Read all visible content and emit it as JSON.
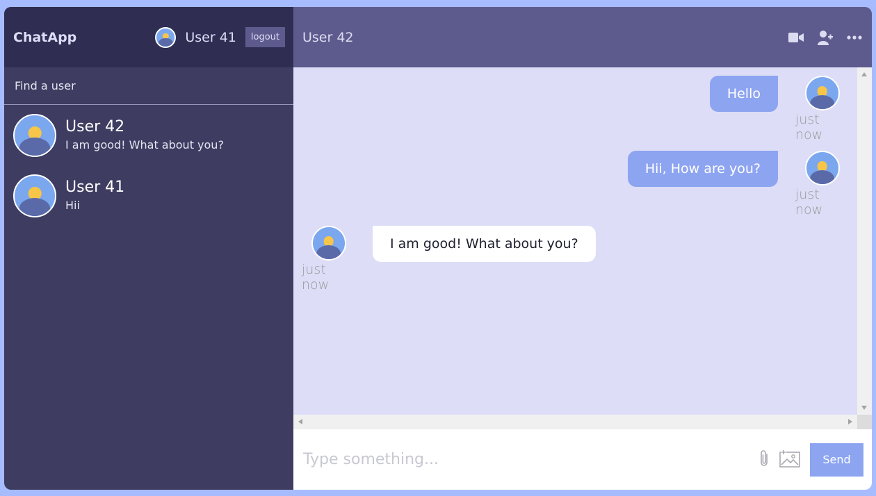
{
  "navbar": {
    "logo": "ChatApp",
    "current_user": "User 41",
    "logout_label": "logout"
  },
  "search": {
    "placeholder": "Find a user"
  },
  "chats": [
    {
      "name": "User 42",
      "last_message": "I am good! What about you?"
    },
    {
      "name": "User 41",
      "last_message": "Hii"
    }
  ],
  "chat_header": {
    "title": "User 42",
    "icons": [
      "video-camera-icon",
      "add-user-icon",
      "more-icon"
    ]
  },
  "messages": [
    {
      "owner": true,
      "text": "Hello",
      "time": "just now"
    },
    {
      "owner": true,
      "text": "Hii, How are you?",
      "time": "just now"
    },
    {
      "owner": false,
      "text": "I am good! What about you?",
      "time": "just now"
    }
  ],
  "input": {
    "placeholder": "Type something...",
    "send_label": "Send",
    "icons": [
      "attach-icon",
      "image-icon"
    ]
  },
  "colors": {
    "page_bg": "#a7bcff",
    "sidebar_bg": "#3e3c61",
    "sidebar_header_bg": "#2f2d52",
    "chat_header_bg": "#5d5b8d",
    "messages_bg": "#ddddf7",
    "owner_bubble": "#8da4f1",
    "send_button": "#8da4f1"
  }
}
